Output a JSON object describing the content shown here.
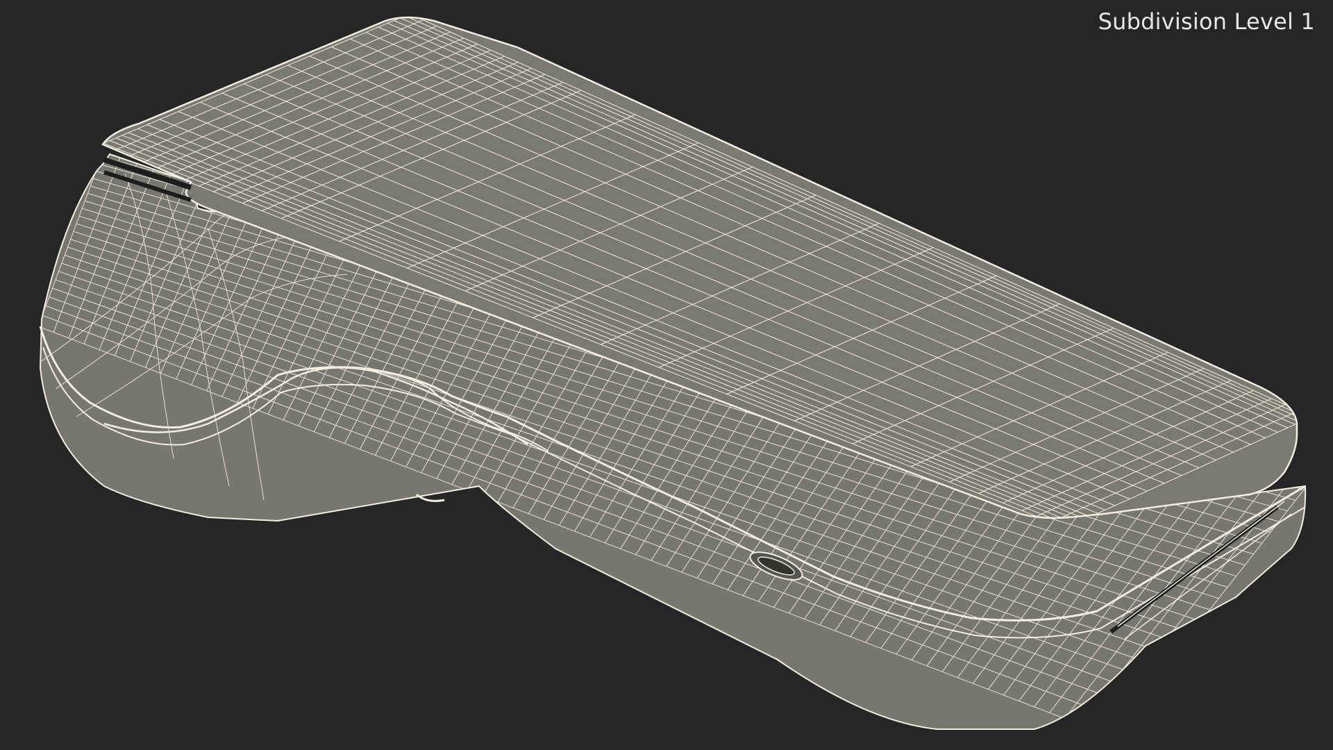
{
  "viewport": {
    "label": "Subdivision Level 1",
    "background_color": "#262626",
    "model_fill_color": "#7a7a70",
    "wire_color": "#f2efe2",
    "label_color": "#e8e8e8"
  }
}
